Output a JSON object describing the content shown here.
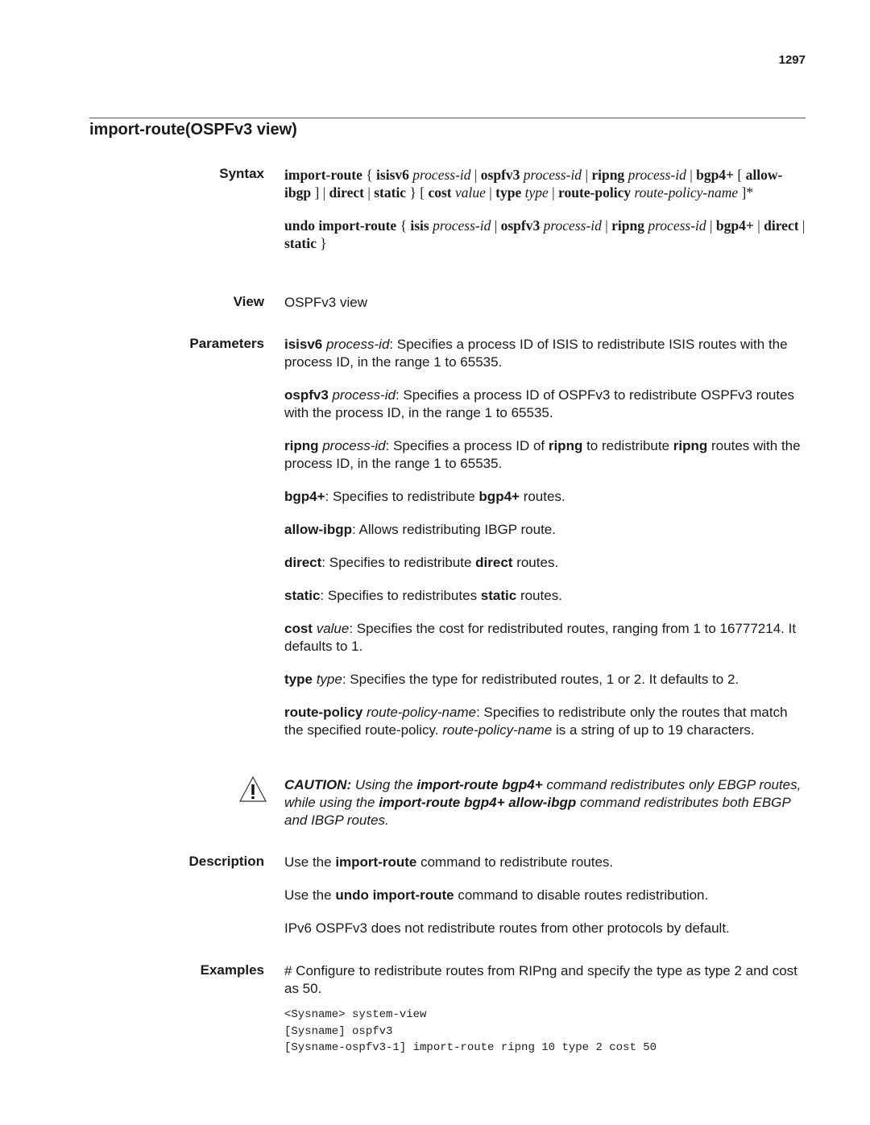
{
  "page_number": "1297",
  "title": "import-route(OSPFv3 view)",
  "sections": {
    "syntax": {
      "label": "Syntax",
      "line1": {
        "cmd": "import-route",
        "p1": " { ",
        "k1": "isisv6",
        "a1": " process-id",
        "s1": " | ",
        "k2": "ospfv3",
        "a2": " process-id",
        "s2": " | ",
        "k3": "ripng",
        "a3": " process-id",
        "s3": " | ",
        "k4": "bgp4+",
        "p2": " [ ",
        "k5": "allow-ibgp",
        "p3": " ] | ",
        "k6": "direct",
        "s4": " | ",
        "k7": "static",
        "p4": " } [ ",
        "k8": "cost",
        "a4": " value",
        "s5": " | ",
        "k9": "type",
        "a5": " type",
        "s6": " | ",
        "k10": "route-policy",
        "a6": " route-policy-name",
        "p5": " ]*"
      },
      "line2": {
        "cmd": "undo import-route",
        "p1": " { ",
        "k1": "isis",
        "a1": " process-id",
        "s1": " | ",
        "k2": "ospfv3",
        "a2": " process-id",
        "s2": " | ",
        "k3": "ripng",
        "a3": " process-id",
        "s3": " | ",
        "k4": "bgp4+",
        "s4": " | ",
        "k5": "direct",
        "s5": " | ",
        "k6": "static",
        "p2": " }"
      }
    },
    "view": {
      "label": "View",
      "text": "OSPFv3 view"
    },
    "parameters": {
      "label": "Parameters",
      "isisv6": {
        "kw": "isisv6",
        "arg": " process-id",
        "text": ": Specifies a process ID of ISIS to redistribute ISIS routes with the process ID, in the range 1 to 65535."
      },
      "ospfv3": {
        "kw": "ospfv3",
        "arg": " process-id",
        "text": ": Specifies a process ID of OSPFv3 to redistribute OSPFv3 routes with the process ID, in the range 1 to 65535."
      },
      "ripng": {
        "kw": "ripng",
        "arg": " process-id",
        "t1": ": Specifies a process ID of ",
        "kw2": "ripng",
        "t2": " to redistribute ",
        "kw3": "ripng",
        "t3": " routes with the process ID, in the range 1 to 65535."
      },
      "bgp4": {
        "kw": "bgp4+",
        "t1": ": Specifies to redistribute ",
        "kw2": "bgp4+",
        "t2": " routes."
      },
      "allow_ibgp": {
        "kw": "allow-ibgp",
        "text": ": Allows redistributing IBGP route."
      },
      "direct": {
        "kw": "direct",
        "t1": ": Specifies to redistribute ",
        "kw2": "direct",
        "t2": " routes."
      },
      "static": {
        "kw": "static",
        "t1": ": Specifies to redistributes ",
        "kw2": "static",
        "t2": " routes."
      },
      "cost": {
        "kw": "cost",
        "arg": " value",
        "text": ": Specifies the cost for redistributed routes, ranging from 1 to 16777214. It defaults to 1."
      },
      "type": {
        "kw": "type",
        "arg": " type",
        "text": ": Specifies the type for redistributed routes, 1 or 2. It defaults to 2."
      },
      "route_policy": {
        "kw": "route-policy",
        "arg": " route-policy-name",
        "t1": ": Specifies to redistribute only the routes that match the specified route-policy. ",
        "arg2": "route-policy-name",
        "t2": " is a string of up to 19 characters."
      }
    },
    "caution": {
      "icon": "warning-triangle-icon",
      "label": "CAUTION:",
      "t1": " Using the ",
      "b1": "import-route bgp4+",
      "t2": " command redistributes only EBGP routes, while using the ",
      "b2": "import-route bgp4+ allow-ibgp",
      "t3": " command redistributes both EBGP and IBGP routes."
    },
    "description": {
      "label": "Description",
      "p1": {
        "t1": "Use the ",
        "b": "import-route",
        "t2": " command to redistribute routes."
      },
      "p2": {
        "t1": "Use the ",
        "b": "undo import-route",
        "t2": " command to disable routes redistribution."
      },
      "p3": "IPv6 OSPFv3 does not redistribute routes from other protocols by default."
    },
    "examples": {
      "label": "Examples",
      "intro": "# Configure to redistribute routes from RIPng and specify the type as type 2 and cost as 50.",
      "code": [
        "<Sysname> system-view",
        "[Sysname] ospfv3",
        "[Sysname-ospfv3-1] import-route ripng 10 type 2 cost 50"
      ]
    }
  }
}
